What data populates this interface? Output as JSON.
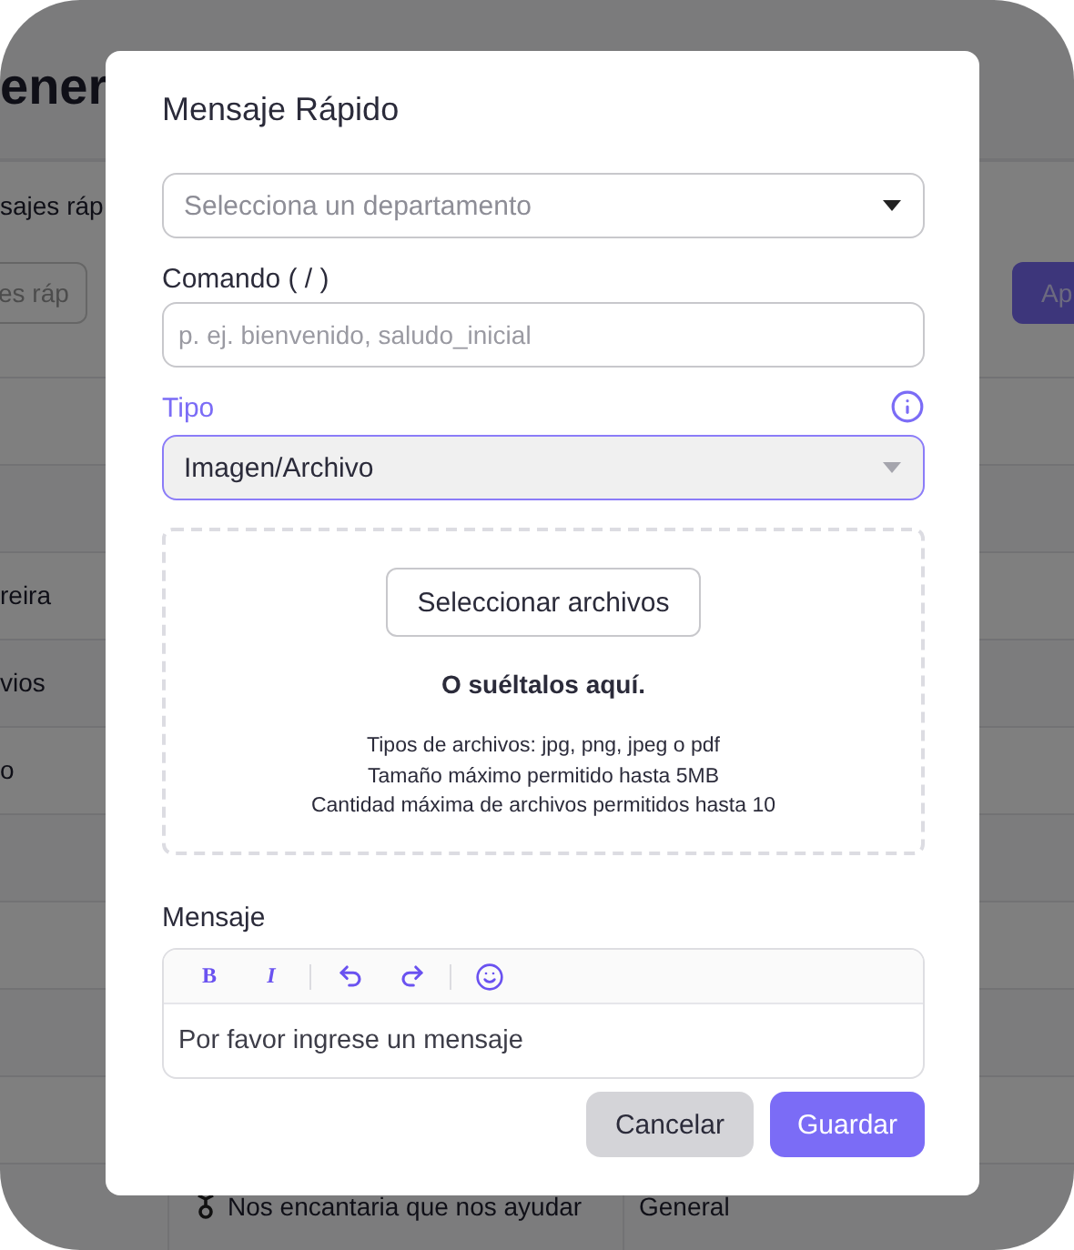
{
  "background": {
    "heading": "ener",
    "subtitle": "sajes ráp",
    "search": {
      "placeholder": "es ráp"
    },
    "button": "Ap",
    "rows": [
      {},
      {},
      {
        "column_1": "reira"
      },
      {
        "column_1": "vios"
      },
      {
        "column_1": "o"
      },
      {},
      {},
      {},
      {},
      {
        "column_2": "Nos encantaria que nos ayudar",
        "column_3": "General"
      }
    ]
  },
  "modal": {
    "title": "Mensaje Rápido",
    "department": {
      "placeholder": "Selecciona un departamento"
    },
    "command": {
      "label": "Comando ( / )",
      "placeholder": "p. ej. bienvenido, saludo_inicial"
    },
    "type": {
      "label": "Tipo",
      "value": "Imagen/Archivo",
      "focused": true
    },
    "upload": {
      "button": "Seleccionar archivos",
      "drop_text": "O suéltalos aquí.",
      "info": [
        "Tipos de archivos: jpg, png, jpeg o pdf",
        "Tamaño máximo permitido hasta 5MB",
        "Cantidad máxima de archivos permitidos hasta 10"
      ]
    },
    "message": {
      "label": "Mensaje",
      "placeholder": "Por favor ingrese un mensaje",
      "toolbar": [
        {
          "kind": "bold",
          "label": "B"
        },
        {
          "kind": "italic",
          "label": "I"
        },
        {
          "kind": "separator"
        },
        {
          "kind": "undo"
        },
        {
          "kind": "redo"
        },
        {
          "kind": "separator"
        },
        {
          "kind": "emoji"
        }
      ]
    },
    "buttons": [
      {
        "kind": "secondary",
        "label": "Cancelar"
      },
      {
        "kind": "primary",
        "label": "Guardar"
      }
    ]
  }
}
